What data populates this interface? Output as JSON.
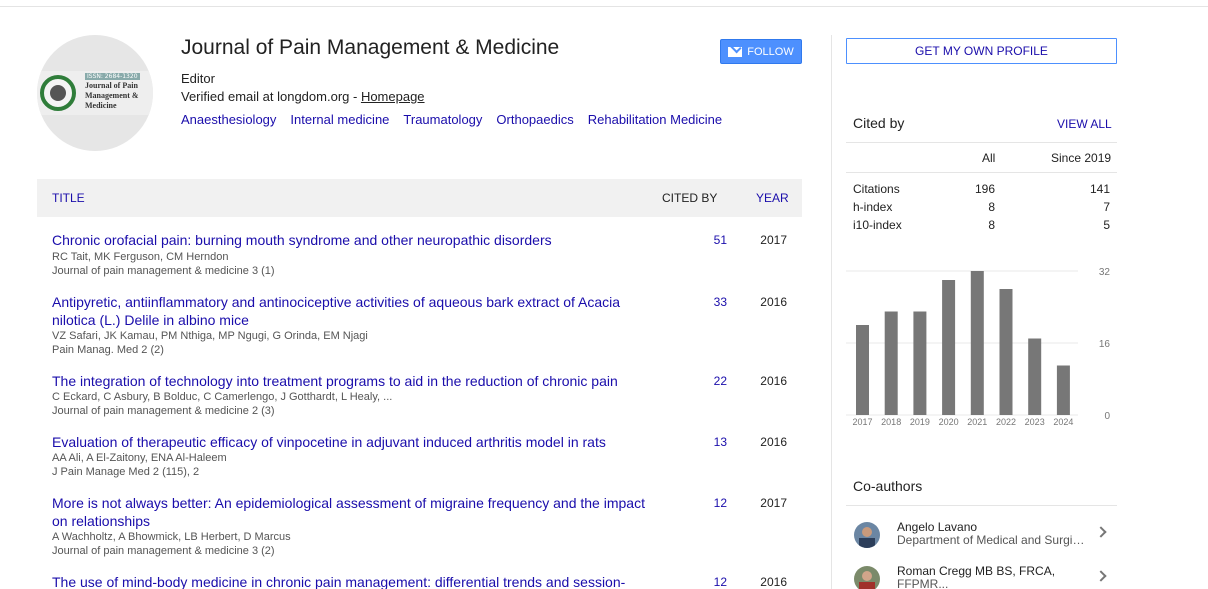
{
  "profile": {
    "name": "Journal of Pain Management & Medicine",
    "affiliation": "Editor",
    "email_text": "Verified email at longdom.org - ",
    "homepage_label": "Homepage",
    "interests": [
      "Anaesthesiology",
      "Internal medicine",
      "Traumatology",
      "Orthopaedics",
      "Rehabilitation Medicine"
    ],
    "follow_label": "FOLLOW",
    "logo": {
      "issn": "ISSN: 2684-1320",
      "text": "Journal of Pain Management & Medicine",
      "color": "#2f7d3a"
    }
  },
  "table": {
    "headers": {
      "title": "TITLE",
      "cited_by": "CITED BY",
      "year": "YEAR"
    },
    "rows": [
      {
        "title": "Chronic orofacial pain: burning mouth syndrome and other neuropathic disorders",
        "authors": "RC Tait, MK Ferguson, CM Herndon",
        "venue": "Journal of pain management & medicine 3 (1)",
        "cited": "51",
        "year": "2017"
      },
      {
        "title": "Antipyretic, antiinflammatory and antinociceptive activities of aqueous bark extract of Acacia nilotica (L.) Delile in albino mice",
        "authors": "VZ Safari, JK Kamau, PM Nthiga, MP Ngugi, G Orinda, EM Njagi",
        "venue": "Pain Manag. Med 2 (2)",
        "cited": "33",
        "year": "2016"
      },
      {
        "title": "The integration of technology into treatment programs to aid in the reduction of chronic pain",
        "authors": "C Eckard, C Asbury, B Bolduc, C Camerlengo, J Gotthardt, L Healy, ...",
        "venue": "Journal of pain management & medicine 2 (3)",
        "cited": "22",
        "year": "2016"
      },
      {
        "title": "Evaluation of therapeutic efficacy of vinpocetine in adjuvant induced arthritis model in rats",
        "authors": "AA Ali, A El-Zaitony, ENA Al-Haleem",
        "venue": "J Pain Manage Med 2 (115), 2",
        "cited": "13",
        "year": "2016"
      },
      {
        "title": "More is not always better: An epidemiological assessment of migraine frequency and the impact on relationships",
        "authors": "A Wachholtz, A Bhowmick, LB Herbert, D Marcus",
        "venue": "Journal of pain management & medicine 3 (2)",
        "cited": "12",
        "year": "2017"
      },
      {
        "title": "The use of mind-body medicine in chronic pain management: differential trends and session-",
        "authors": "",
        "venue": "",
        "cited": "12",
        "year": "2016"
      }
    ]
  },
  "sidebar": {
    "profile_button": "GET MY OWN PROFILE",
    "cited_by_title": "Cited by",
    "view_all": "VIEW ALL",
    "col_all": "All",
    "col_since": "Since 2019",
    "stats": [
      {
        "label": "Citations",
        "all": "196",
        "since": "141"
      },
      {
        "label": "h-index",
        "all": "8",
        "since": "7"
      },
      {
        "label": "i10-index",
        "all": "8",
        "since": "5"
      }
    ],
    "coauthors_title": "Co-authors",
    "coauthors": [
      {
        "name": "Angelo Lavano",
        "affiliation": "Department of Medical and Surgical Sciences"
      },
      {
        "name": "Roman Cregg MB BS, FRCA,",
        "affiliation": "FFPMR..."
      }
    ]
  },
  "chart_data": {
    "type": "bar",
    "categories": [
      "2017",
      "2018",
      "2019",
      "2020",
      "2021",
      "2022",
      "2023",
      "2024"
    ],
    "values": [
      20,
      23,
      23,
      30,
      32,
      28,
      17,
      11
    ],
    "yticks": [
      "0",
      "16",
      "32"
    ],
    "ylim": [
      0,
      32
    ],
    "bar_color": "#777777"
  }
}
